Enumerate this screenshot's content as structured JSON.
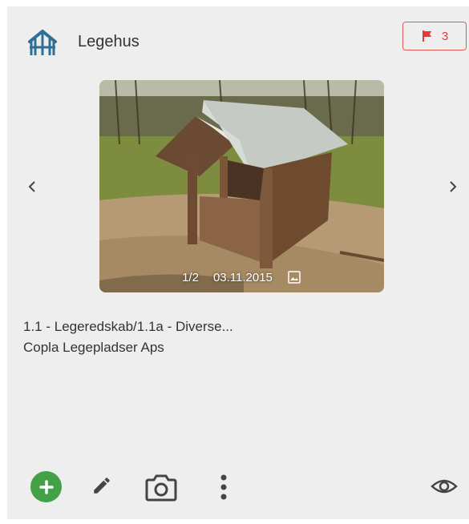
{
  "header": {
    "title": "Legehus",
    "icon": "playhouse-icon",
    "flag_count": "3",
    "accent_color": "#2e6f96",
    "flag_color": "#e53935"
  },
  "gallery": {
    "counter": "1/2",
    "date": "03.11.2015"
  },
  "details": {
    "category": "1.1 - Legeredskab/1.1a - Diverse...",
    "supplier": "Copla Legepladser Aps"
  },
  "toolbar": {
    "add_color": "#43a047",
    "icons": [
      "add-icon",
      "edit-icon",
      "camera-icon",
      "more-vertical-icon",
      "eye-icon"
    ]
  }
}
